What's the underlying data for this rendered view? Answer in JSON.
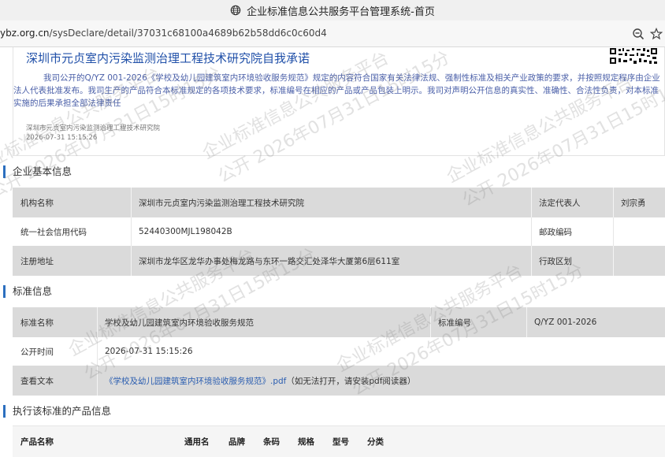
{
  "window": {
    "title": "企业标准信息公共服务平台管理系统-首页"
  },
  "address_bar": {
    "url_host": "ybz.org.cn",
    "url_path": "/sysDeclare/detail/37031c68100a4689b62b58dd6c0c60d4"
  },
  "promise": {
    "title": "深圳市元贞室内污染监测治理工程技术研究院自我承诺",
    "text": "我司公开的Q/YZ 001-2026《学校及幼儿园建筑室内环境验收服务规范》规定的内容符合国家有关法律法规、强制性标准及相关产业政策的要求，并按照规定程序由企业法人代表批准发布。我司生产的产品符合本标准规定的各项技术要求，标准编号在相应的产品或产品包装上明示。我司对声明公开信息的真实性、准确性、合法性负责，对本标准实施的后果承担全部法律责任",
    "org": "深圳市元贞室内污染监测治理工程技术研究院",
    "datetime": "2026-07-31 15:15:26"
  },
  "enterprise": {
    "heading": "企业基本信息",
    "org_name_label": "机构名称",
    "org_name_value": "深圳市元贞室内污染监测治理工程技术研究院",
    "legal_rep_label": "法定代表人",
    "legal_rep_value": "刘宗勇",
    "credit_code_label": "统一社会信用代码",
    "credit_code_value": "52440300MJL198042B",
    "postal_label": "邮政编码",
    "postal_value": "",
    "address_label": "注册地址",
    "address_value": "深圳市龙华区龙华办事处梅龙路与东环一路交汇处泽华大厦第6层611室",
    "district_label": "行政区划",
    "district_value": ""
  },
  "standard": {
    "heading": "标准信息",
    "name_label": "标准名称",
    "name_value": "学校及幼儿园建筑室内环境验收服务规范",
    "number_label": "标准编号",
    "number_value": "Q/YZ 001-2026",
    "publish_label": "公开时间",
    "publish_value": "2026-07-31 15:15:26",
    "view_label": "查看文本",
    "view_link": "《学校及幼儿园建筑室内环境验收服务规范》.pdf",
    "view_hint": "（如无法打开，请安装pdf阅读器）"
  },
  "products": {
    "heading": "执行该标准的产品信息",
    "columns": [
      "产品名称",
      "通用名",
      "品牌",
      "条码",
      "规格",
      "型号",
      "分类"
    ]
  },
  "watermark": {
    "line1": "企业标准信息公共服务平台",
    "line2": "公开 2026年07月31日15时15分"
  }
}
